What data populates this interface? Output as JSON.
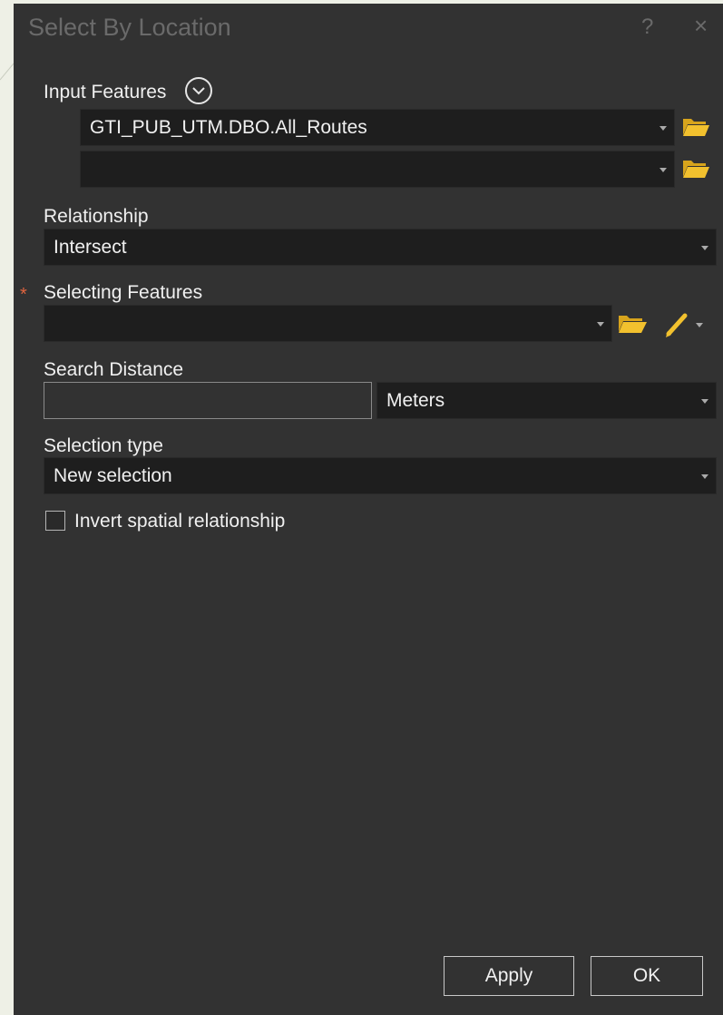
{
  "window": {
    "title": "Select By Location",
    "help_label": "?",
    "close_label": "×"
  },
  "input_features": {
    "label": "Input Features",
    "rows": [
      {
        "value": "GTI_PUB_UTM.DBO.All_Routes"
      },
      {
        "value": ""
      }
    ]
  },
  "relationship": {
    "label": "Relationship",
    "value": "Intersect"
  },
  "selecting_features": {
    "required_marker": "*",
    "label": "Selecting Features",
    "value": ""
  },
  "search_distance": {
    "label": "Search Distance",
    "value": "",
    "unit": "Meters"
  },
  "selection_type": {
    "label": "Selection type",
    "value": "New selection"
  },
  "invert": {
    "label": "Invert spatial relationship",
    "checked": false
  },
  "buttons": {
    "apply": "Apply",
    "ok": "OK"
  },
  "colors": {
    "dialog_bg": "#323232",
    "field_bg": "#1e1e1e",
    "folder_icon": "#f2c12e",
    "required_marker": "#e0643f",
    "background": "#eef0e6"
  },
  "icons": {
    "expand": "chevron-circle-down-icon",
    "browse": "folder-open-icon",
    "sketch": "pencil-icon",
    "dropdown": "caret-down-icon"
  }
}
